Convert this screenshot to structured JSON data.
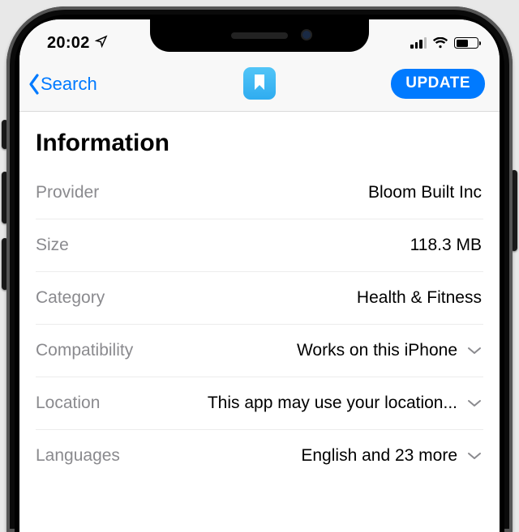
{
  "status": {
    "time": "20:02",
    "location_arrow": true
  },
  "nav": {
    "back_label": "Search",
    "update_label": "UPDATE",
    "app_icon_name": "bookmark-icon"
  },
  "section_title": "Information",
  "rows": [
    {
      "label": "Provider",
      "value": "Bloom Built Inc",
      "expandable": false
    },
    {
      "label": "Size",
      "value": "118.3 MB",
      "expandable": false
    },
    {
      "label": "Category",
      "value": "Health & Fitness",
      "expandable": false
    },
    {
      "label": "Compatibility",
      "value": "Works on this iPhone",
      "expandable": true
    },
    {
      "label": "Location",
      "value": "This app may use your location...",
      "expandable": true
    },
    {
      "label": "Languages",
      "value": "English and 23 more",
      "expandable": true
    }
  ],
  "colors": {
    "tint": "#007aff",
    "icon_gradient_top": "#52c5f7",
    "icon_gradient_bottom": "#2facf0"
  }
}
